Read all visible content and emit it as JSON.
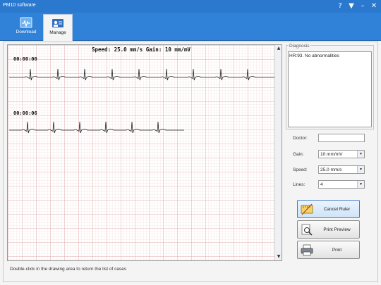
{
  "window": {
    "title": "PM10 software",
    "controls": [
      "?",
      "▼",
      "–",
      "✕"
    ]
  },
  "ribbon": {
    "tabs": [
      {
        "label": "Download",
        "icon": "download-icon"
      },
      {
        "label": "Manage",
        "icon": "manage-icon",
        "selected": true
      }
    ]
  },
  "ecg": {
    "header": "Speed: 25.0 mm/s  Gain: 10 mm/mV",
    "strips": [
      {
        "time": "00:00:00"
      },
      {
        "time": "00:00:06"
      }
    ]
  },
  "hint": "Double-click in the drawing area to return the list of cases",
  "diagnosis": {
    "legend": "Diagnosis",
    "text": "HR:93. No abnormalities"
  },
  "form": {
    "doctor_label": "Doctor:",
    "doctor_value": "",
    "gain_label": "Gain:",
    "gain_value": "10 mm/mV",
    "speed_label": "Speed:",
    "speed_value": "25.0 mm/s",
    "lines_label": "Lines:",
    "lines_value": "4"
  },
  "buttons": {
    "cancel_ruler": "Cancel Ruler",
    "print_preview": "Print Preview",
    "print": "Print"
  },
  "colors": {
    "titlebar": "#2a79cf",
    "ribbon": "#2f82d8",
    "grid_minor": "#f0caca",
    "grid_major": "#e08f8f",
    "trace": "#222222"
  }
}
